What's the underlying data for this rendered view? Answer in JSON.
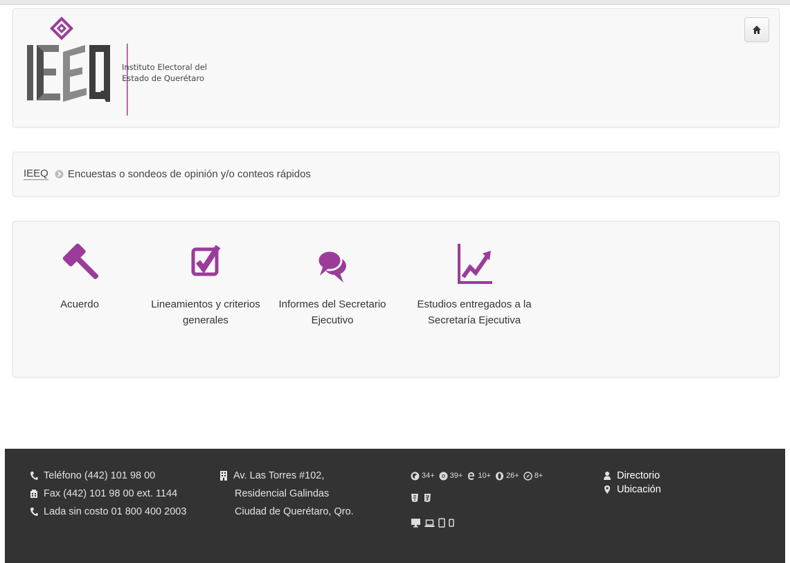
{
  "header": {
    "institute_line1": "Instituto Electoral del",
    "institute_line2": "Estado de Querétaro",
    "home_icon": "home-icon"
  },
  "breadcrumb": {
    "root": "IEEQ",
    "current": "Encuestas o sondeos de opinión y/o conteos rápidos"
  },
  "actions": [
    {
      "label_line1": "Acuerdo",
      "label_line2": "",
      "icon": "gavel-icon"
    },
    {
      "label_line1": "Lineamientos y criterios",
      "label_line2": "generales",
      "icon": "checkbox-icon"
    },
    {
      "label_line1": "Informes del Secretario",
      "label_line2": "Ejecutivo",
      "icon": "comments-icon"
    },
    {
      "label_line1": "Estudios entregados a la",
      "label_line2": "Secretaría Ejecutiva",
      "icon": "chart-line-icon"
    }
  ],
  "colors": {
    "accent": "#9b3c9b",
    "footer_bg": "#333333"
  },
  "footer": {
    "phone": "Teléfono (442) 101 98 00",
    "fax": "Fax (442) 101 98 00 ext. 1144",
    "toll_free": "Lada sin costo 01 800 400 2003",
    "address1": "Av. Las Torres #102,",
    "address2": "Residencial Galindas",
    "address3": "Ciudad de Querétaro, Qro.",
    "browsers": [
      {
        "icon": "firefox-icon",
        "version": "34+"
      },
      {
        "icon": "chrome-icon",
        "version": "39+"
      },
      {
        "icon": "ie-icon",
        "version": "10+"
      },
      {
        "icon": "opera-icon",
        "version": "26+"
      },
      {
        "icon": "safari-icon",
        "version": "8+"
      }
    ],
    "links": {
      "directorio": "Directorio",
      "ubicacion": "Ubicación"
    }
  }
}
